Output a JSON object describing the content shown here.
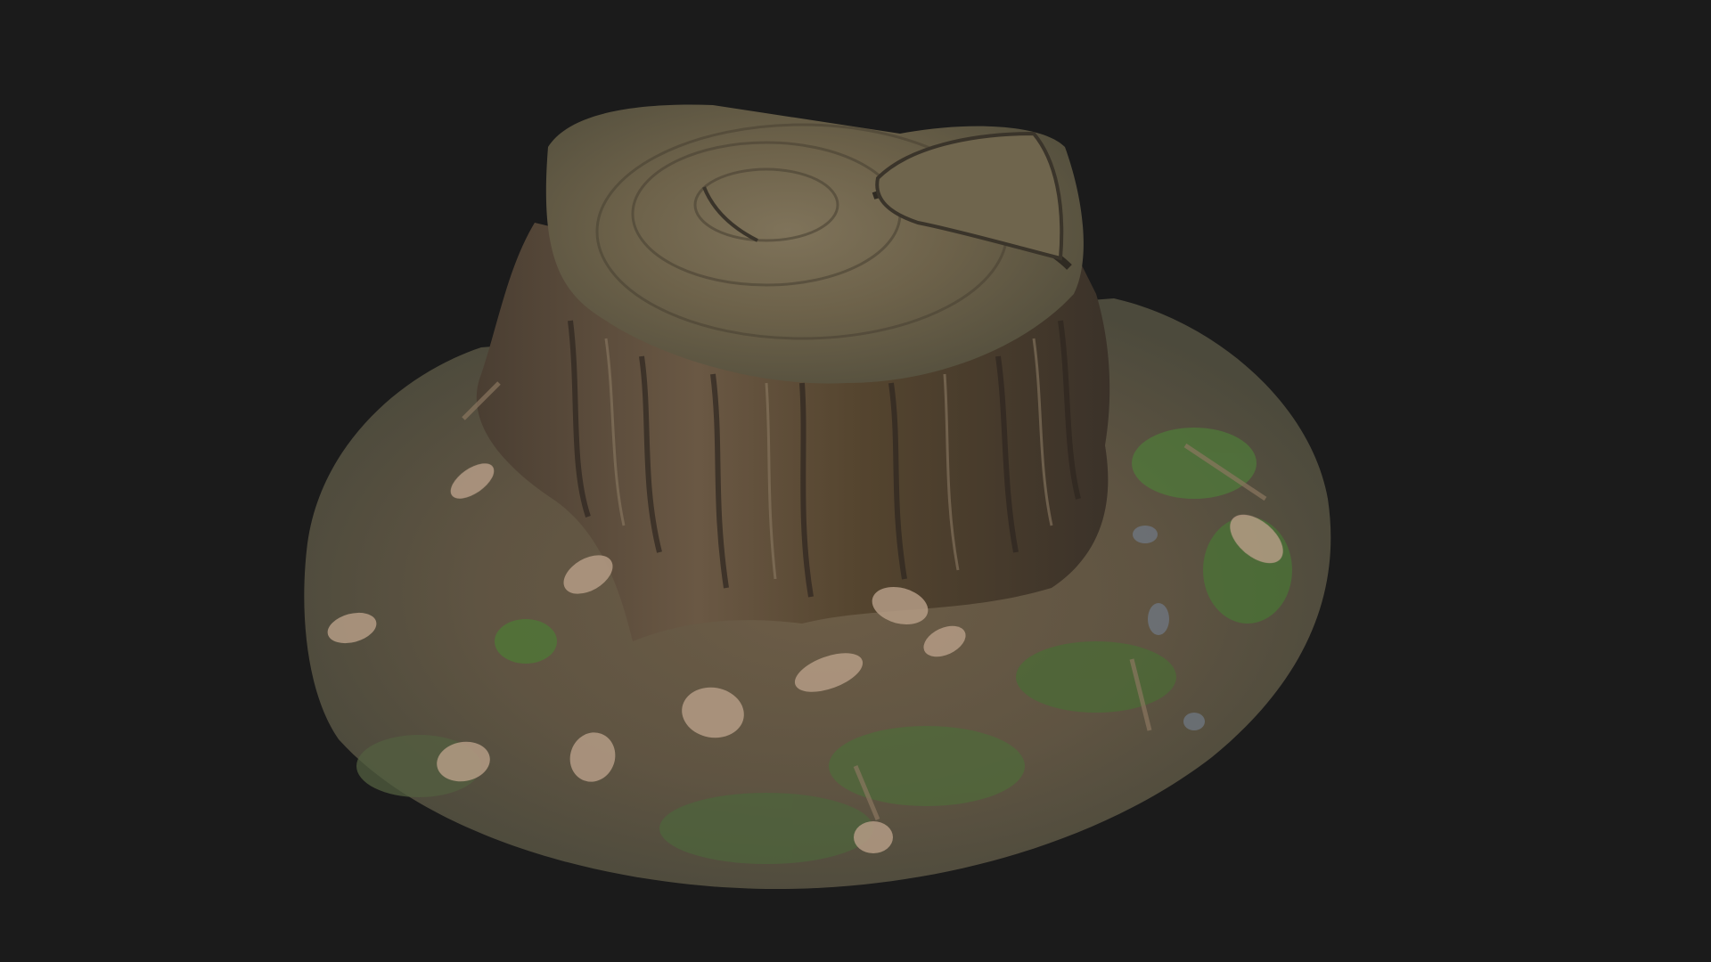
{
  "viewer": {
    "background_color": "#1b1b1b"
  },
  "model": {
    "subject": "tree-stump-scan",
    "colors": {
      "wood_top": "#6b6048",
      "wood_top_light": "#8a7e64",
      "bark_dark": "#3a3128",
      "bark_mid": "#5e5040",
      "ground": "#6a5c48",
      "grass": "#4f7a3a",
      "leaf": "#b59c86"
    }
  }
}
